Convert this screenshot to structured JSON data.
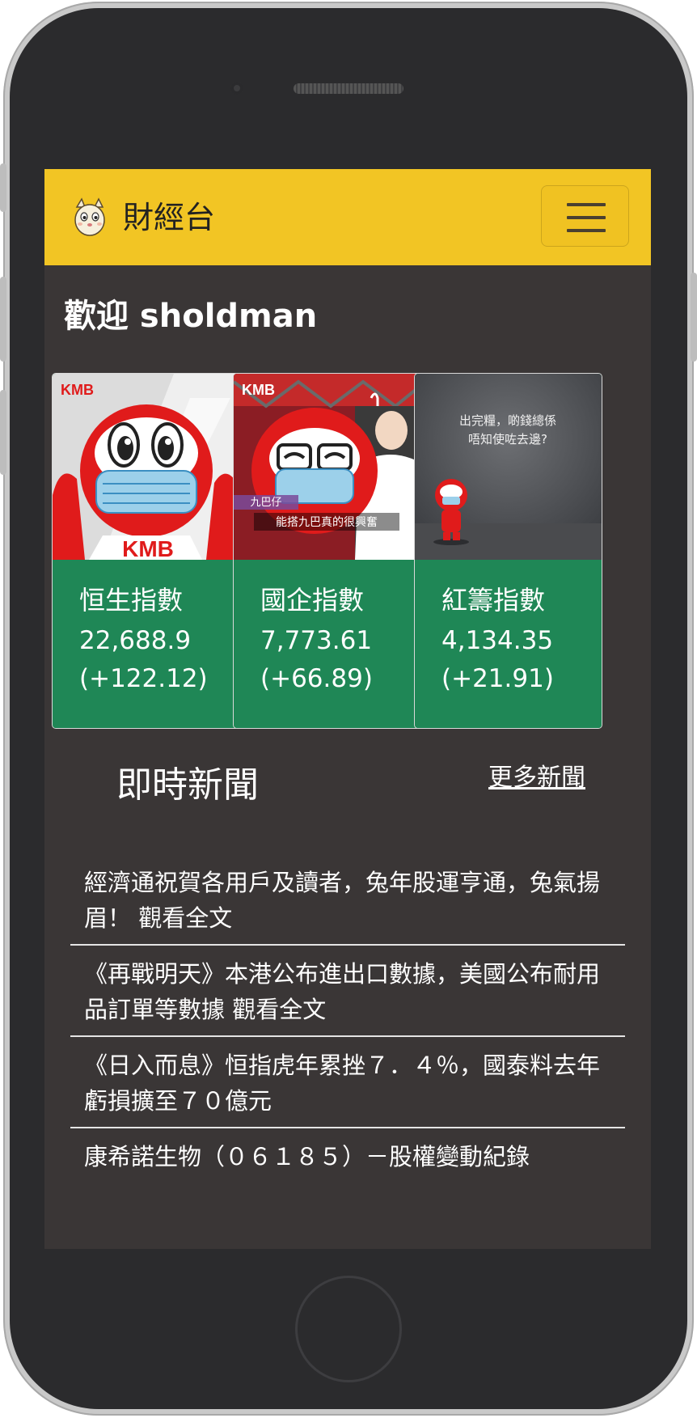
{
  "app": {
    "brand": "財經台"
  },
  "welcome": {
    "text": "歡迎 sholdman"
  },
  "indices": [
    {
      "name": "恒生指數",
      "value": "22,688.9",
      "change": "(+122.12)"
    },
    {
      "name": "國企指數",
      "value": "7,773.61",
      "change": "(+66.89)"
    },
    {
      "name": "紅籌指數",
      "value": "4,134.35",
      "change": "(+21.91)"
    }
  ],
  "card_images": {
    "card1": {
      "logo": "KMB",
      "chest": "KMB"
    },
    "card2": {
      "logo": "KMB",
      "caption_tag": "九巴仔",
      "caption": "能搭九巴真的很興奮"
    },
    "card3": {
      "line1": "出完糧，啲錢總係",
      "line2": "唔知使咗去邊?"
    }
  },
  "news": {
    "title": "即時新聞",
    "more_label": "更多新聞",
    "items": [
      {
        "text": "經濟通祝賀各用戶及讀者，兔年股運亨通，兔氣揚眉！",
        "read_more": "觀看全文"
      },
      {
        "text": "《再戰明天》本港公布進出口數據，美國公布耐用品訂單等數據",
        "read_more": "觀看全文"
      },
      {
        "text": "《日入而息》恒指虎年累挫７．４％，國泰料去年虧損擴至７０億元",
        "read_more": ""
      },
      {
        "text": "康希諾生物（０６１８５）－股權變動紀錄",
        "read_more": ""
      }
    ]
  },
  "colors": {
    "navbar": "#f2c524",
    "screen_bg": "#3a3636",
    "card_body": "#1f8756",
    "mascot_red": "#e01b1b"
  }
}
